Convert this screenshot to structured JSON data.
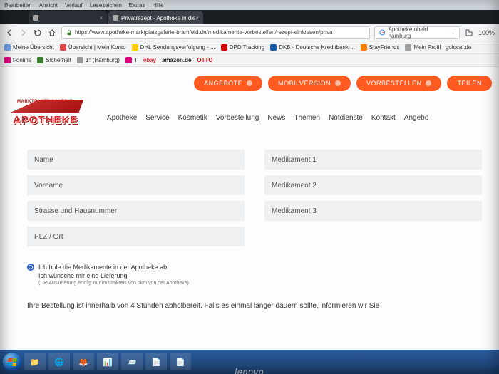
{
  "os_menu": [
    "Bearbeiten",
    "Ansicht",
    "Verlauf",
    "Lesezeichen",
    "Extras",
    "Hilfe"
  ],
  "tabs": [
    {
      "label": "",
      "active": false
    },
    {
      "label": "Privatrezept - Apotheke in die",
      "active": true
    }
  ],
  "url": "https://www.apotheke-marktplatzgalerie-bramfeld.de/medikamente-vorbestellen/rezept-einloesen/priva",
  "searchbox": {
    "value": "Apotheke obeid hamburg"
  },
  "zoom": "100%",
  "bookmarks_row1": [
    {
      "label": "Meine Übersicht",
      "color": "#6aa0e4"
    },
    {
      "label": "Übersicht | Mein Konto",
      "color": "#d44"
    },
    {
      "label": "DHL Sendungsverfolgung - ...",
      "color": "#ffcc00"
    },
    {
      "label": "DPD Tracking",
      "color": "#d40000"
    },
    {
      "label": "DKB - Deutsche Kreditbank ...",
      "color": "#1858a8"
    },
    {
      "label": "StayFriends",
      "color": "#ff7a00"
    },
    {
      "label": "Mein Profil | golocal.de",
      "color": "#9e9e9e"
    }
  ],
  "bookmarks_row2": [
    {
      "label": "t-online",
      "color": "#e2007a"
    },
    {
      "label": "Sicherheit",
      "color": "#3b7d2f"
    },
    {
      "label": "1° (Hamburg)",
      "color": "#999"
    },
    {
      "label": "T",
      "color": "#e2007a"
    },
    {
      "label": "ebay",
      "color": "#e53238"
    },
    {
      "label": "amazon.de",
      "color": "#ff9900"
    },
    {
      "label": "OTTO",
      "color": "#e3000b"
    }
  ],
  "pills": [
    {
      "label": "ANGEBOTE"
    },
    {
      "label": "MOBILVERSION"
    },
    {
      "label": "VORBESTELLEN"
    },
    {
      "label": "TEILEN"
    }
  ],
  "brand": {
    "top": "MARKTPLATZ GALERIE",
    "bottom": "APOTHEKE"
  },
  "nav": [
    "Apotheke",
    "Service",
    "Kosmetik",
    "Vorbestellung",
    "News",
    "Themen",
    "Notdienste",
    "Kontakt",
    "Angebo"
  ],
  "form": {
    "name": "Name",
    "vorname": "Vorname",
    "strasse": "Strasse und Hausnummer",
    "plz": "PLZ / Ort",
    "med1": "Medikament 1",
    "med2": "Medikament 2",
    "med3": "Medikament 3"
  },
  "radios": {
    "opt1": "Ich hole die Medikamente in der Apotheke ab",
    "opt2": "Ich wünsche mir eine Lieferung",
    "note": "(Die Auslieferung erfolgt nur im Umkreis von 5km von der Apotheke)"
  },
  "info": "Ihre Bestellung ist innerhalb von 4 Stunden abholbereit. Falls es einmal länger dauern sollte, informieren wir Sie",
  "taskbar_icons": [
    "📁",
    "🌐",
    "🦊",
    "📊",
    "📨",
    "📄",
    "📄"
  ]
}
